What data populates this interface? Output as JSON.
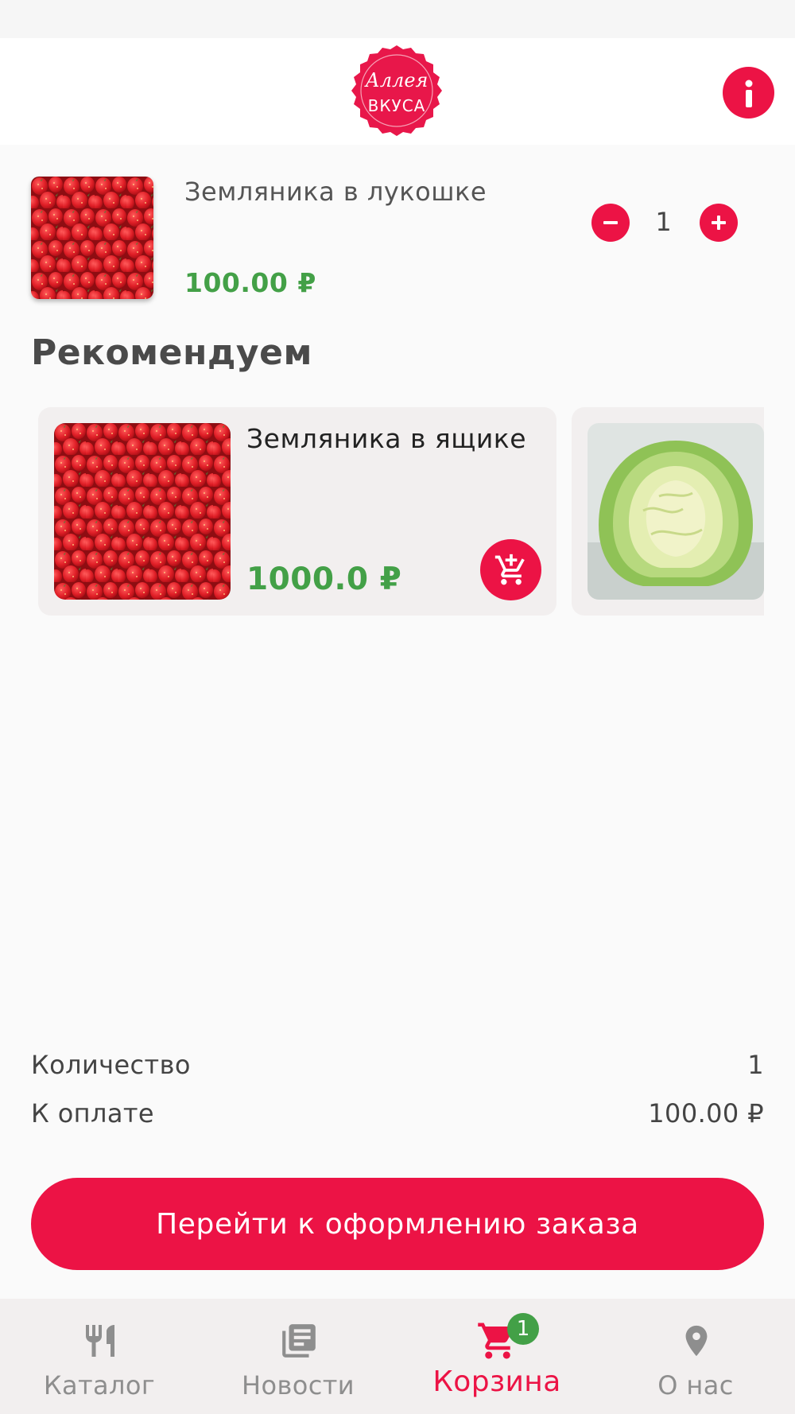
{
  "header": {
    "logo_line1": "Аллея",
    "logo_line2": "ВКУСА",
    "info_icon": "info-icon"
  },
  "cart": {
    "items": [
      {
        "name": "Земляника в лукошке",
        "price": "100.00 ₽",
        "quantity": "1",
        "image": "strawberries-photo"
      }
    ]
  },
  "recommend": {
    "title": "Рекомендуем",
    "items": [
      {
        "name": "Земляника в ящике",
        "price": "1000.0 ₽",
        "image": "strawberries-photo",
        "action_icon": "add-shopping-cart-icon"
      },
      {
        "name": "",
        "price": "",
        "image": "cabbage-photo"
      }
    ]
  },
  "summary": {
    "qty_label": "Количество",
    "qty_value": "1",
    "total_label": "К оплате",
    "total_value": "100.00 ₽"
  },
  "checkout": {
    "label": "Перейти к оформлению заказа"
  },
  "nav": {
    "items": [
      {
        "label": "Каталог",
        "icon": "fork-knife-icon",
        "active": false
      },
      {
        "label": "Новости",
        "icon": "newspaper-icon",
        "active": false
      },
      {
        "label": "Корзина",
        "icon": "cart-icon",
        "active": true,
        "badge": "1"
      },
      {
        "label": "О нас",
        "icon": "location-pin-icon",
        "active": false
      }
    ]
  },
  "colors": {
    "accent": "#ec1345",
    "price_green": "#43a047",
    "card_bg": "#f2efef",
    "inactive_nav": "#8e8e8e"
  }
}
